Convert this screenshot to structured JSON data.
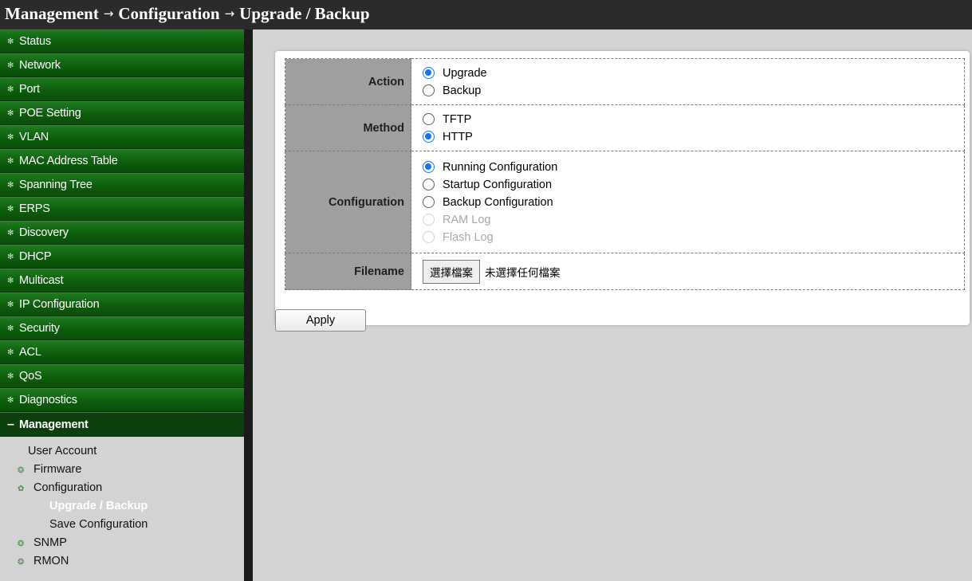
{
  "title": {
    "part1": "Management",
    "part2": "Configuration",
    "part3": "Upgrade / Backup",
    "separator": "→"
  },
  "sidebar": {
    "collapsed_icon": "✻",
    "expanded_icon": "–",
    "items": [
      {
        "label": "Status"
      },
      {
        "label": "Network"
      },
      {
        "label": "Port"
      },
      {
        "label": "POE Setting"
      },
      {
        "label": "VLAN"
      },
      {
        "label": "MAC Address Table"
      },
      {
        "label": "Spanning Tree"
      },
      {
        "label": "ERPS"
      },
      {
        "label": "Discovery"
      },
      {
        "label": "DHCP"
      },
      {
        "label": "Multicast"
      },
      {
        "label": "IP Configuration"
      },
      {
        "label": "Security"
      },
      {
        "label": "ACL"
      },
      {
        "label": "QoS"
      },
      {
        "label": "Diagnostics"
      }
    ],
    "open_item": {
      "label": "Management"
    },
    "sub_items": {
      "user_account": "User Account",
      "firmware": "Firmware",
      "configuration": "Configuration",
      "upgrade_backup": "Upgrade / Backup",
      "save_configuration": "Save Configuration",
      "snmp": "SNMP",
      "rmon": "RMON"
    }
  },
  "form": {
    "action": {
      "label": "Action",
      "options": [
        {
          "label": "Upgrade",
          "checked": true
        },
        {
          "label": "Backup",
          "checked": false
        }
      ]
    },
    "method": {
      "label": "Method",
      "options": [
        {
          "label": "TFTP",
          "checked": false
        },
        {
          "label": "HTTP",
          "checked": true
        }
      ]
    },
    "configuration": {
      "label": "Configuration",
      "options": [
        {
          "label": "Running Configuration",
          "checked": true,
          "disabled": false
        },
        {
          "label": "Startup Configuration",
          "checked": false,
          "disabled": false
        },
        {
          "label": "Backup Configuration",
          "checked": false,
          "disabled": false
        },
        {
          "label": "RAM Log",
          "checked": false,
          "disabled": true
        },
        {
          "label": "Flash Log",
          "checked": false,
          "disabled": true
        }
      ]
    },
    "filename": {
      "label": "Filename",
      "button_label": "選擇檔案",
      "no_file_text": "未選擇任何檔案"
    }
  },
  "apply_label": "Apply",
  "colors": {
    "menu_green": "#0c5a0c",
    "radio_checked": "#1a73e8",
    "title_bar": "#2b2b2b",
    "label_cell": "#9f9f9f"
  }
}
